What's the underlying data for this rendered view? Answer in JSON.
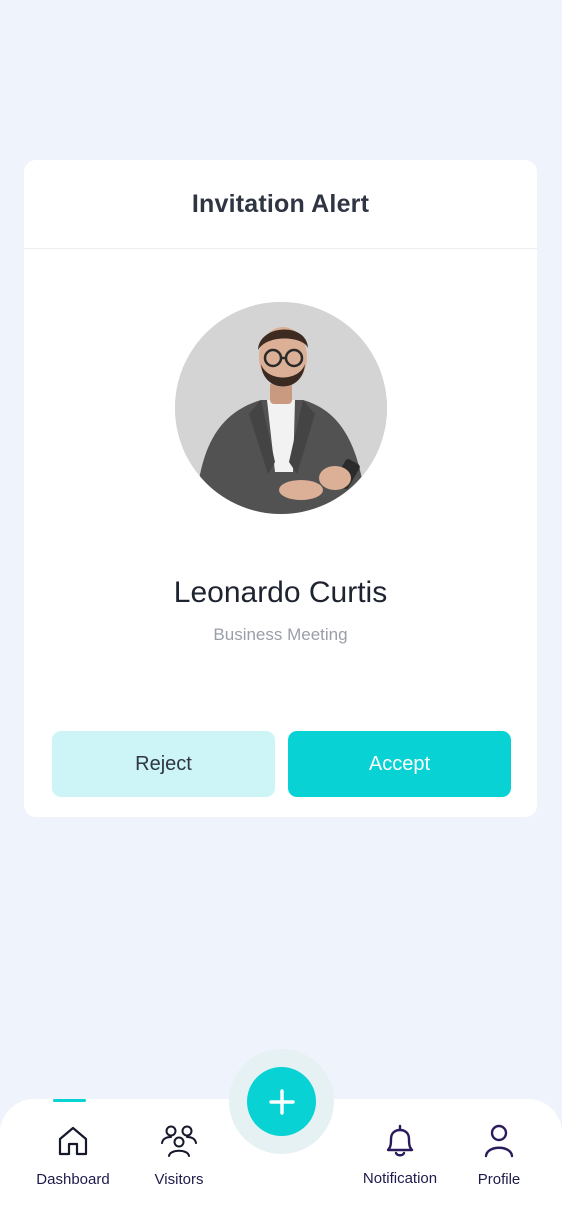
{
  "alert": {
    "title": "Invitation Alert",
    "visitor_name": "Leonardo Curtis",
    "purpose": "Business Meeting",
    "reject_label": "Reject",
    "accept_label": "Accept"
  },
  "colors": {
    "accent": "#09d2d4",
    "accent_light": "#cdf4f6",
    "background": "#eff3fb",
    "nav_text": "#1e1b4b"
  },
  "nav": {
    "active": "Dashboard",
    "items": [
      {
        "label": "Dashboard",
        "icon": "home-icon"
      },
      {
        "label": "Visitors",
        "icon": "visitors-icon"
      },
      {
        "label": "Notification",
        "icon": "bell-icon"
      },
      {
        "label": "Profile",
        "icon": "user-icon"
      }
    ],
    "fab_icon": "plus-icon"
  }
}
